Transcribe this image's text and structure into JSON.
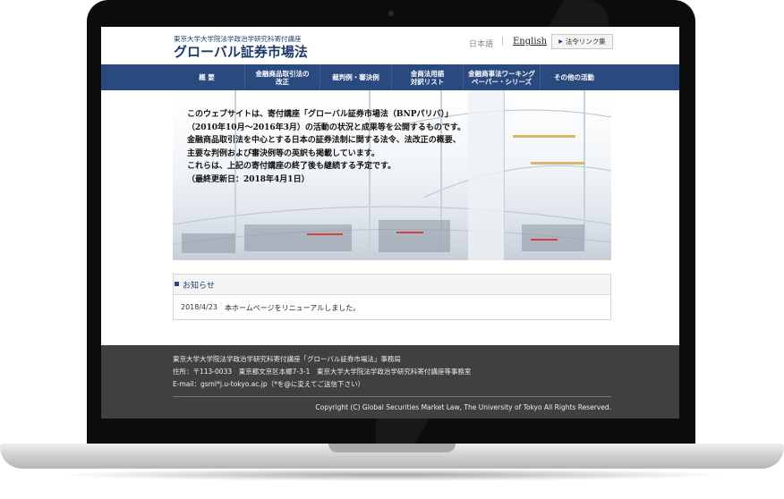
{
  "header": {
    "subtitle": "東京大学大学院法学政治学研究科寄付講座",
    "title": "グローバル証券市場法",
    "lang_ja": "日本語",
    "lang_separator": "|",
    "lang_en": "English",
    "law_link_label": "法令リンク集"
  },
  "nav": {
    "items": [
      {
        "label": "概 要"
      },
      {
        "label": "金融商品取引法の\n改正"
      },
      {
        "label": "裁判例・審決例"
      },
      {
        "label": "金商法用語\n対訳リスト"
      },
      {
        "label": "金融商事法ワーキング\nペーパー・シリーズ"
      },
      {
        "label": "その他の活動"
      }
    ]
  },
  "hero": {
    "lines": [
      "このウェブサイトは、寄付講座「グローバル証券市場法（BNPパリバ）」",
      "（2010年10月〜2016年3月）の活動の状況と成果等を公開するものです。",
      "金融商品取引法を中心とする日本の証券法制に関する法令、法改正の概要、",
      "主要な判例および審決例等の英訳も掲載しています。",
      "これらは、上記の寄付講座の終了後も継続する予定です。",
      "（最終更新日：2018年4月1日）"
    ]
  },
  "news": {
    "title": "お知らせ",
    "items": [
      {
        "date": "2018/4/23",
        "text": "本ホームページをリニューアルしました。"
      }
    ]
  },
  "footer": {
    "office": "東京大学大学院法学政治学研究科寄付講座「グローバル証券市場法」事務局",
    "address": "住所：〒113-0033　東京都文京区本郷7-3-1　東京大学大学院法学政治学研究科寄付講座等事務室",
    "email": "E-mail：gsml*j.u-tokyo.ac.jp（*を@に変えてご送信下さい）",
    "copyright": "Copyright (C) Global Securities Market Law, The University of Tokyo All Rights Reserved."
  },
  "colors": {
    "navy": "#2a4a7f",
    "title": "#1f3a6a",
    "footer_bg": "#404040"
  }
}
